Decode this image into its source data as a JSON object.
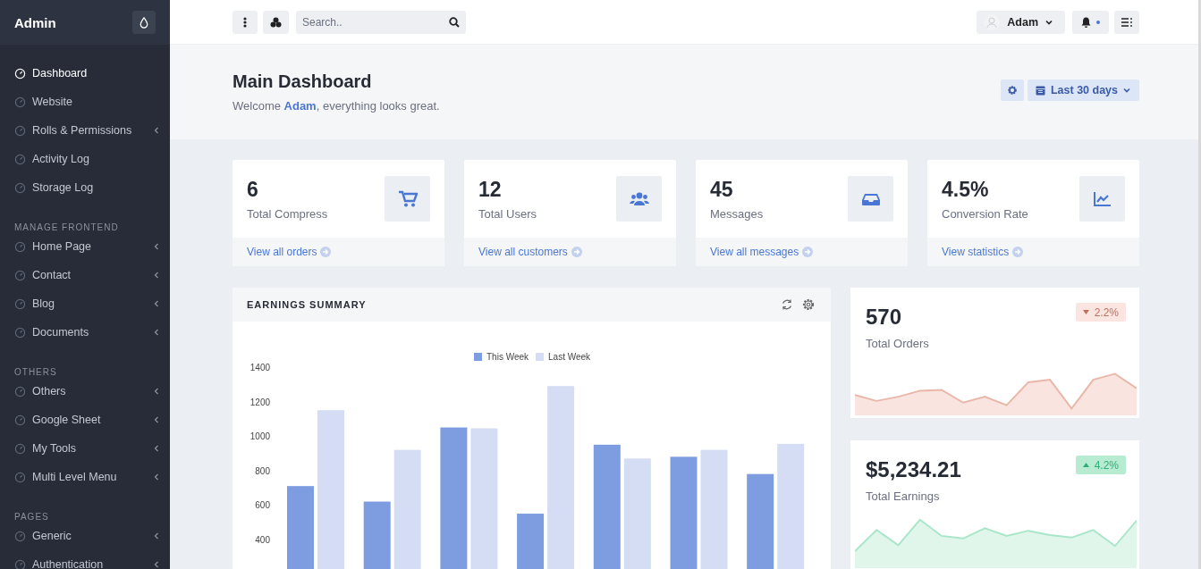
{
  "sidebar": {
    "brand": "Admin",
    "sections": [
      {
        "items": [
          {
            "label": "Dashboard",
            "selected": true,
            "has_submenu": false
          },
          {
            "label": "Website",
            "selected": false,
            "has_submenu": false
          },
          {
            "label": "Rolls & Permissions",
            "selected": false,
            "has_submenu": true
          },
          {
            "label": "Activity Log",
            "selected": false,
            "has_submenu": false
          },
          {
            "label": "Storage Log",
            "selected": false,
            "has_submenu": false
          }
        ]
      },
      {
        "heading": "MANAGE FRONTEND",
        "items": [
          {
            "label": "Home Page",
            "selected": false,
            "has_submenu": true
          },
          {
            "label": "Contact",
            "selected": false,
            "has_submenu": true
          },
          {
            "label": "Blog",
            "selected": false,
            "has_submenu": true
          },
          {
            "label": "Documents",
            "selected": false,
            "has_submenu": true
          }
        ]
      },
      {
        "heading": "OTHERS",
        "items": [
          {
            "label": "Others",
            "selected": false,
            "has_submenu": true
          },
          {
            "label": "Google Sheet",
            "selected": false,
            "has_submenu": true
          },
          {
            "label": "My Tools",
            "selected": false,
            "has_submenu": true
          },
          {
            "label": "Multi Level Menu",
            "selected": false,
            "has_submenu": true
          }
        ]
      },
      {
        "heading": "PAGES",
        "items": [
          {
            "label": "Generic",
            "selected": false,
            "has_submenu": true
          },
          {
            "label": "Authentication",
            "selected": false,
            "has_submenu": true
          }
        ]
      }
    ]
  },
  "topbar": {
    "search": {
      "placeholder": "Search.."
    },
    "user": {
      "name": "Adam"
    },
    "notifications": {
      "unread": true
    }
  },
  "header": {
    "title": "Main Dashboard",
    "welcome": {
      "before": "Welcome ",
      "name": "Adam",
      "after": ", everything looks great."
    },
    "date_range": "Last 30 days"
  },
  "stats": [
    {
      "value": "6",
      "label": "Total Compress",
      "link": "View all orders"
    },
    {
      "value": "12",
      "label": "Total Users",
      "link": "View all customers"
    },
    {
      "value": "45",
      "label": "Messages",
      "link": "View all messages"
    },
    {
      "value": "4.5%",
      "label": "Conversion Rate",
      "link": "View statistics"
    }
  ],
  "earnings_summary": {
    "title": "EARNINGS SUMMARY",
    "chart_data": {
      "type": "bar",
      "categories": [
        null,
        null,
        null,
        null,
        null,
        null,
        null
      ],
      "legend": "top",
      "ylim": [
        200,
        1400
      ],
      "yticks": [
        400,
        600,
        800,
        1000,
        1200,
        1400
      ],
      "series": [
        {
          "name": "This Week",
          "color": "#7e9ce0",
          "values": [
            710,
            620,
            1050,
            550,
            950,
            880,
            780
          ]
        },
        {
          "name": "Last Week",
          "color": "#d4ddf4",
          "values": [
            1150,
            920,
            1045,
            1290,
            870,
            920,
            955
          ]
        }
      ]
    }
  },
  "summary_cards": [
    {
      "value": "570",
      "label": "Total Orders",
      "change": "2.2%",
      "kind": "down"
    },
    {
      "value": "$5,234.21",
      "label": "Total Earnings",
      "change": "4.2%",
      "kind": "up"
    }
  ]
}
